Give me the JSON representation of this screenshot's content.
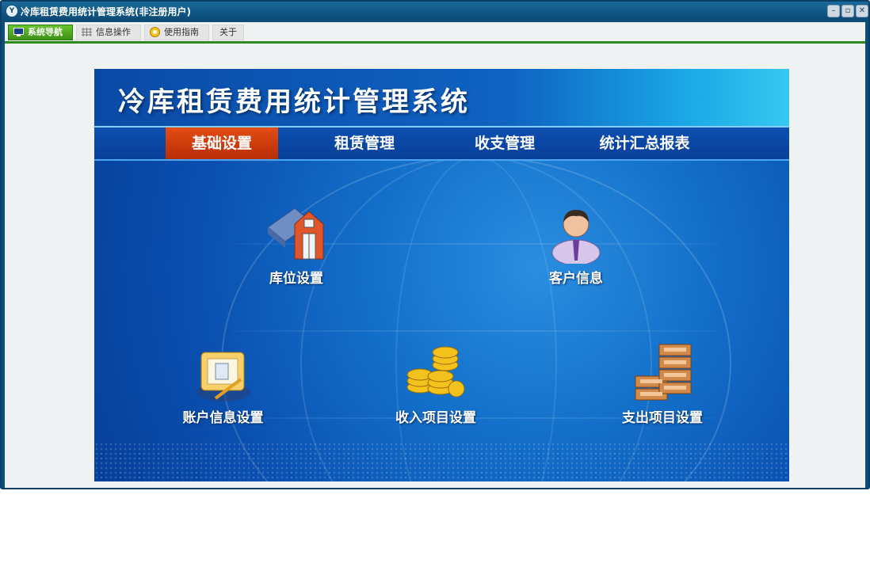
{
  "window": {
    "title": "冷库租赁费用统计管理系统(非注册用户)",
    "app_icon_text": "Y"
  },
  "tabs": [
    {
      "label": "系统导航",
      "icon": "monitor-icon",
      "active": true
    },
    {
      "label": "信息操作",
      "icon": "grid-icon",
      "active": false
    },
    {
      "label": "使用指南",
      "icon": "help-icon",
      "active": false
    },
    {
      "label": "关于",
      "icon": "",
      "active": false
    }
  ],
  "panel": {
    "title": "冷库租赁费用统计管理系统",
    "nav": [
      {
        "label": "基础设置",
        "active": true
      },
      {
        "label": "租赁管理",
        "active": false
      },
      {
        "label": "收支管理",
        "active": false
      },
      {
        "label": "统计汇总报表",
        "active": false
      }
    ],
    "items": [
      {
        "label": "库位设置",
        "icon": "warehouse-icon"
      },
      {
        "label": "客户信息",
        "icon": "customer-icon"
      },
      {
        "label": "账户信息设置",
        "icon": "account-icon"
      },
      {
        "label": "收入项目设置",
        "icon": "coins-icon"
      },
      {
        "label": "支出项目设置",
        "icon": "expense-icon"
      }
    ]
  },
  "colors": {
    "titlebar": "#0b4a74",
    "accent_green": "#3d8f15",
    "nav_active": "#d8420c",
    "panel_blue": "#136fc9"
  }
}
